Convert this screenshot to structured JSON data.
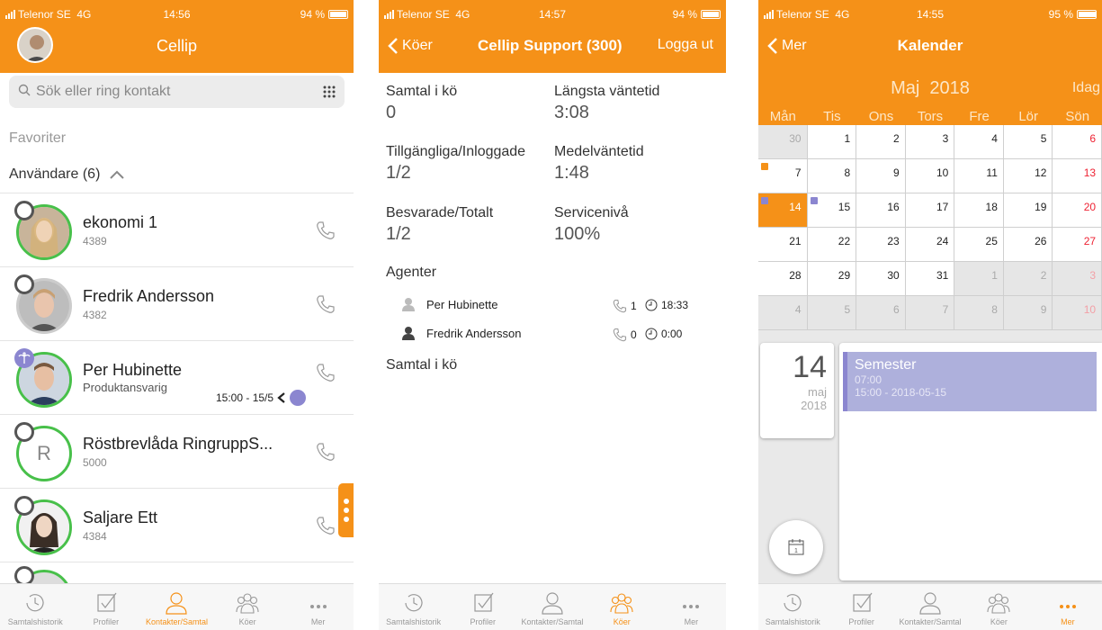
{
  "status": {
    "carrier": "Telenor SE",
    "network": "4G"
  },
  "screen1": {
    "time": "14:56",
    "battery": "94 %",
    "title": "Cellip",
    "search_placeholder": "Sök eller ring kontakt",
    "favorites": "Favoriter",
    "users_header": "Användare (6)",
    "contacts": [
      {
        "name": "ekonomi 1",
        "sub": "4389"
      },
      {
        "name": "Fredrik Andersson",
        "sub": "4382"
      },
      {
        "name": "Per Hubinette",
        "sub": "Produktansvarig",
        "note": "15:00 - 15/5"
      },
      {
        "name": "Röstbrevlåda RingruppS...",
        "sub": "5000",
        "initial": "R"
      },
      {
        "name": "Saljare Ett",
        "sub": "4384"
      }
    ]
  },
  "screen2": {
    "time": "14:57",
    "battery": "94 %",
    "back": "Köer",
    "title": "Cellip Support (300)",
    "logout": "Logga ut",
    "stats": [
      {
        "label": "Samtal i kö",
        "value": "0"
      },
      {
        "label": "Längsta väntetid",
        "value": "3:08"
      },
      {
        "label": "Tillgängliga/Inloggade",
        "value": "1/2"
      },
      {
        "label": "Medelväntetid",
        "value": "1:48"
      },
      {
        "label": "Besvarade/Totalt",
        "value": "1/2"
      },
      {
        "label": "Servicenivå",
        "value": "100%"
      }
    ],
    "agents_label": "Agenter",
    "agents": [
      {
        "name": "Per Hubinette",
        "calls": "1",
        "time": "18:33"
      },
      {
        "name": "Fredrik Andersson",
        "calls": "0",
        "time": "0:00"
      }
    ],
    "queue_label": "Samtal i kö"
  },
  "screen3": {
    "time": "14:55",
    "battery": "95 %",
    "back": "Mer",
    "title": "Kalender",
    "month": "Maj  2018",
    "today": "Idag",
    "weekdays": [
      "Mån",
      "Tis",
      "Ons",
      "Tors",
      "Fre",
      "Lör",
      "Sön"
    ],
    "weeks": [
      [
        "30",
        "1",
        "2",
        "3",
        "4",
        "5",
        "6"
      ],
      [
        "7",
        "8",
        "9",
        "10",
        "11",
        "12",
        "13"
      ],
      [
        "14",
        "15",
        "16",
        "17",
        "18",
        "19",
        "20"
      ],
      [
        "21",
        "22",
        "23",
        "24",
        "25",
        "26",
        "27"
      ],
      [
        "28",
        "29",
        "30",
        "31",
        "1",
        "2",
        "3"
      ],
      [
        "4",
        "5",
        "6",
        "7",
        "8",
        "9",
        "10"
      ]
    ],
    "day": "14",
    "day_month": "maj",
    "day_year": "2018",
    "event": {
      "title": "Semester",
      "time": "07:00",
      "range": "15:00 - 2018-05-15"
    },
    "cal_icon_day": "1"
  },
  "tabs": [
    "Samtalshistorik",
    "Profiler",
    "Kontakter/Samtal",
    "Köer",
    "Mer"
  ],
  "colors": {
    "accent": "#f59118",
    "presence": "#48c04a",
    "event": "#aeb0dc"
  }
}
